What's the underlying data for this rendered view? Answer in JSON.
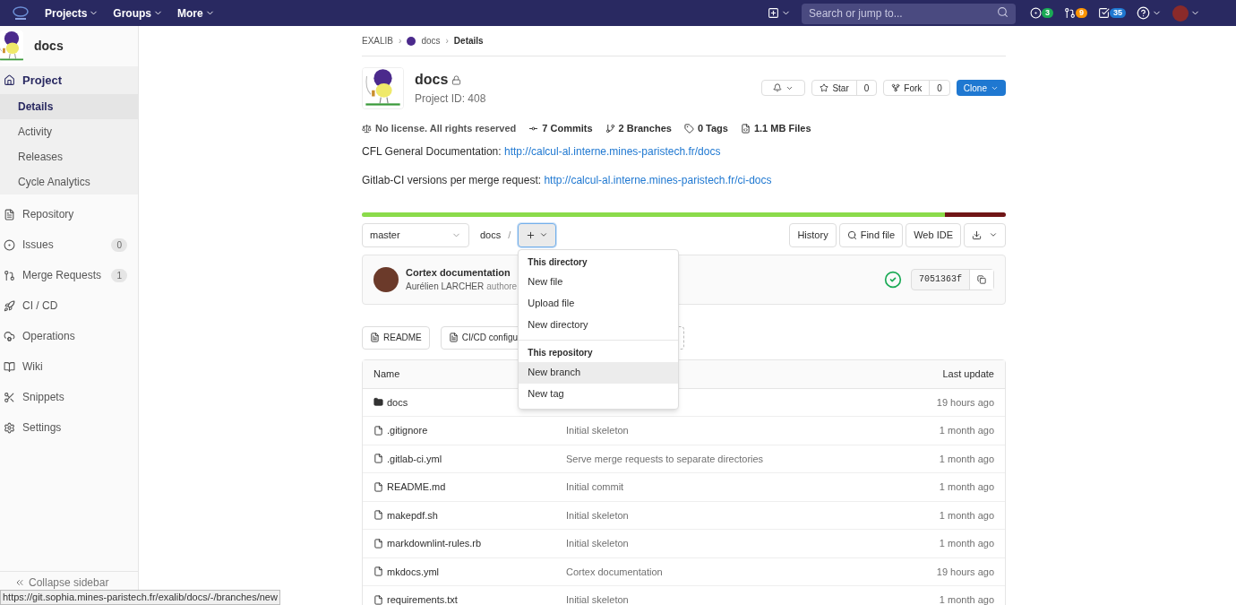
{
  "topbar": {
    "menus": [
      "Projects",
      "Groups",
      "More"
    ],
    "search": {
      "placeholder": "Search or jump to..."
    },
    "counters": [
      {
        "kind": "issues",
        "count": "3",
        "color": "#1aaa55"
      },
      {
        "kind": "merge",
        "count": "9",
        "color": "#fc9403"
      },
      {
        "kind": "todos",
        "count": "35",
        "color": "#1f78d1"
      }
    ]
  },
  "sidebar": {
    "project": "docs",
    "items": [
      {
        "kind": "project",
        "label": "Project",
        "selected": true,
        "children": [
          {
            "label": "Details",
            "selected": true
          },
          {
            "label": "Activity",
            "selected": false
          },
          {
            "label": "Releases",
            "selected": false
          },
          {
            "label": "Cycle Analytics",
            "selected": false
          }
        ]
      },
      {
        "kind": "repository",
        "label": "Repository",
        "selected": false
      },
      {
        "kind": "issues",
        "label": "Issues",
        "count": "0",
        "selected": false
      },
      {
        "kind": "merge",
        "label": "Merge Requests",
        "count": "1",
        "selected": false
      },
      {
        "kind": "cicd",
        "label": "CI / CD",
        "selected": false
      },
      {
        "kind": "operations",
        "label": "Operations",
        "selected": false
      },
      {
        "kind": "wiki",
        "label": "Wiki",
        "selected": false
      },
      {
        "kind": "snippets",
        "label": "Snippets",
        "selected": false
      },
      {
        "kind": "settings",
        "label": "Settings",
        "selected": false
      }
    ],
    "collapse": "Collapse sidebar"
  },
  "breadcrumbs": [
    {
      "label": "EXALIB",
      "avatar": false,
      "current": false
    },
    {
      "separator": "›",
      "label": "docs",
      "avatar": true,
      "current": false
    },
    {
      "separator": "›",
      "label": "Details",
      "avatar": false,
      "current": true
    }
  ],
  "project": {
    "name": "docs",
    "private": true,
    "id_text": "Project ID: 408",
    "star": {
      "label": "Star",
      "count": "0"
    },
    "fork": {
      "label": "Fork",
      "count": "0"
    },
    "clone": "Clone",
    "stats": [
      {
        "kind": "license",
        "label": "No license. All rights reserved"
      },
      {
        "kind": "commits",
        "label": "7 Commits"
      },
      {
        "kind": "branches",
        "label": "2 Branches"
      },
      {
        "kind": "tags",
        "label": "0 Tags"
      },
      {
        "kind": "files",
        "label": "1.1 MB Files"
      }
    ],
    "description": [
      {
        "text": "CFL General Documentation: ",
        "link": "http://calcul-al.interne.mines-paristech.fr/docs"
      },
      {
        "text": "Gitlab-CI versions per merge request: ",
        "link": "http://calcul-al.interne.mines-paristech.fr/ci-docs"
      }
    ]
  },
  "languages": [
    {
      "level": 0.905,
      "color": "#8bdb4b"
    },
    {
      "level": 0.095,
      "color": "#701516"
    }
  ],
  "toolbar": {
    "branch": "master",
    "path": "docs",
    "separator": "/",
    "buttons": [
      "History",
      "Find file",
      "Web IDE"
    ]
  },
  "commit": {
    "title": "Cortex documentation",
    "author": "Aurélien LARCHER",
    "authored": "authore",
    "sha": "7051363f",
    "passed": true
  },
  "shortcuts": [
    "README",
    "CI/CD configu"
  ],
  "dropdown": {
    "sections": [
      {
        "title": "This directory",
        "items": [
          {
            "label": "New file",
            "selected": false
          },
          {
            "label": "Upload file",
            "selected": false
          },
          {
            "label": "New directory",
            "selected": false
          }
        ]
      },
      {
        "title": "This repository",
        "items": [
          {
            "label": "New branch",
            "selected": true
          },
          {
            "label": "New tag",
            "selected": false
          }
        ]
      }
    ]
  },
  "table": {
    "columns": [
      "Name",
      "Last update"
    ],
    "rows": [
      {
        "kind": "folder",
        "name": "docs",
        "update": "19 hours ago"
      },
      {
        "kind": "file",
        "name": ".gitignore",
        "commit": "Initial skeleton",
        "update": "1 month ago"
      },
      {
        "kind": "file",
        "name": ".gitlab-ci.yml",
        "commit": "Serve merge requests to separate directories",
        "update": "1 month ago"
      },
      {
        "kind": "file",
        "name": "README.md",
        "commit": "Initial commit",
        "update": "1 month ago"
      },
      {
        "kind": "file",
        "name": "makepdf.sh",
        "commit": "Initial skeleton",
        "update": "1 month ago"
      },
      {
        "kind": "file",
        "name": "markdownlint-rules.rb",
        "commit": "Initial skeleton",
        "update": "1 month ago"
      },
      {
        "kind": "file",
        "name": "mkdocs.yml",
        "commit": "Cortex documentation",
        "update": "19 hours ago"
      },
      {
        "kind": "file",
        "name": "requirements.txt",
        "commit": "Initial skeleton",
        "update": "1 month ago"
      }
    ]
  },
  "status_url": "https://git.sophia.mines-paristech.fr/exalib/docs/-/branches/new"
}
